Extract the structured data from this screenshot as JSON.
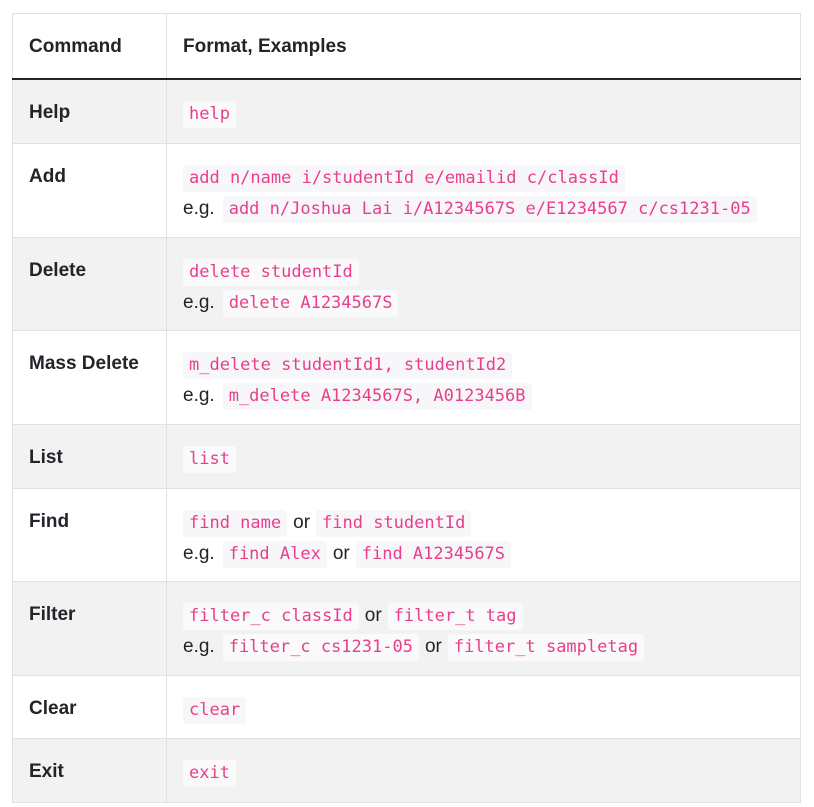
{
  "header": {
    "command": "Command",
    "format": "Format, Examples"
  },
  "connector": "or",
  "example_prefix": "e.g.",
  "rows": [
    {
      "command": "Help",
      "format": [
        "help"
      ],
      "example": null
    },
    {
      "command": "Add",
      "format": [
        "add n/name i/studentId e/emailid c/classId"
      ],
      "example": [
        "add n/Joshua Lai i/A1234567S e/E1234567 c/cs1231-05"
      ]
    },
    {
      "command": "Delete",
      "format": [
        "delete studentId"
      ],
      "example": [
        "delete A1234567S"
      ]
    },
    {
      "command": "Mass Delete",
      "format": [
        "m_delete studentId1, studentId2"
      ],
      "example": [
        "m_delete A1234567S, A0123456B"
      ]
    },
    {
      "command": "List",
      "format": [
        "list"
      ],
      "example": null
    },
    {
      "command": "Find",
      "format": [
        "find name",
        "find studentId"
      ],
      "example": [
        "find Alex",
        "find A1234567S"
      ]
    },
    {
      "command": "Filter",
      "format": [
        "filter_c classId",
        "filter_t tag"
      ],
      "example": [
        "filter_c cs1231-05",
        "filter_t sampletag"
      ]
    },
    {
      "command": "Clear",
      "format": [
        "clear"
      ],
      "example": null
    },
    {
      "command": "Exit",
      "format": [
        "exit"
      ],
      "example": null
    }
  ]
}
